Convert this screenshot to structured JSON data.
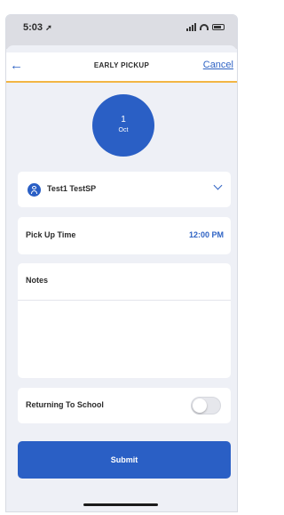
{
  "status_bar": {
    "time": "5:03",
    "location_icon": "location-arrow-icon"
  },
  "nav": {
    "back_icon": "back-arrow-icon",
    "title": "EARLY PICKUP",
    "cancel_label": "Cancel"
  },
  "date": {
    "day": "1",
    "month": "Oct"
  },
  "student": {
    "name": "Test1 TestSP",
    "avatar_icon": "person-icon",
    "chevron_icon": "chevron-down-icon"
  },
  "pickup": {
    "label": "Pick Up Time",
    "value": "12:00 PM"
  },
  "notes": {
    "label": "Notes",
    "value": ""
  },
  "returning": {
    "label": "Returning To School",
    "enabled": false
  },
  "submit": {
    "label": "Submit"
  },
  "colors": {
    "primary": "#2a5fc5",
    "accent": "#f2b544",
    "background": "#eef0f6"
  }
}
